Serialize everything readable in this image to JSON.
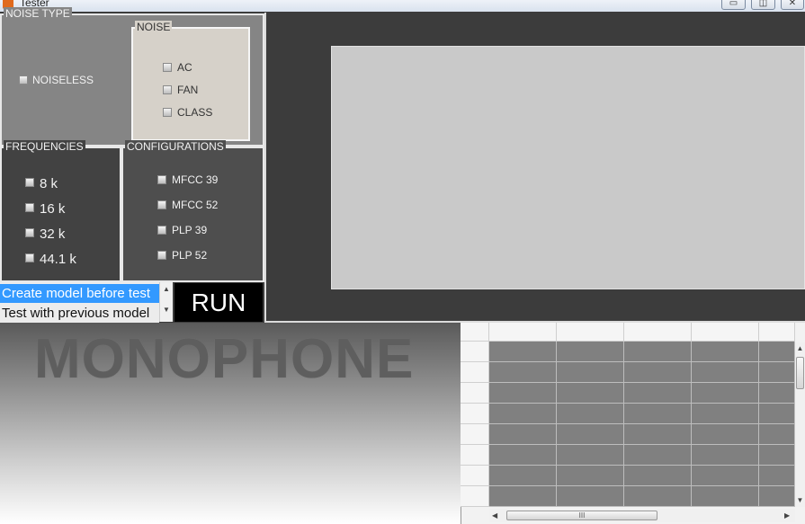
{
  "window": {
    "title": "Tester",
    "buttons": {
      "minimize": "▭",
      "maximize": "◫",
      "close": "✕"
    }
  },
  "noise_type": {
    "title": "NOISE TYPE",
    "noiseless": {
      "label": "NOISELESS",
      "checked": false
    },
    "noise": {
      "title": "NOISE",
      "options": [
        {
          "label": "AC",
          "checked": false
        },
        {
          "label": "FAN",
          "checked": false
        },
        {
          "label": "CLASS",
          "checked": false
        }
      ]
    }
  },
  "frequencies": {
    "title": "FREQUENCIES",
    "options": [
      {
        "label": "8 k",
        "checked": false
      },
      {
        "label": "16 k",
        "checked": false
      },
      {
        "label": "32 k",
        "checked": false
      },
      {
        "label": "44.1 k",
        "checked": false
      }
    ]
  },
  "configurations": {
    "title": "CONFIGURATIONS",
    "options": [
      {
        "label": "MFCC 39",
        "checked": false
      },
      {
        "label": "MFCC 52",
        "checked": false
      },
      {
        "label": "PLP 39",
        "checked": false
      },
      {
        "label": "PLP 52",
        "checked": false
      }
    ]
  },
  "model_list": {
    "items": [
      {
        "label": "Create model before test",
        "selected": true
      },
      {
        "label": "Test with previous model",
        "selected": false
      }
    ]
  },
  "run_button": {
    "label": "RUN"
  },
  "banner": {
    "text": "MONOPHONE"
  },
  "table": {
    "scroll_up": "▲",
    "scroll_down": "▼",
    "scroll_left": "◀",
    "scroll_right": "▶",
    "thumb_grip": "III"
  },
  "colors": {
    "accent_selection": "#3399ff",
    "cell_fill": "#808080",
    "plot_bg": "#c9c9c9",
    "panel_bg": "#3c3c3c"
  }
}
